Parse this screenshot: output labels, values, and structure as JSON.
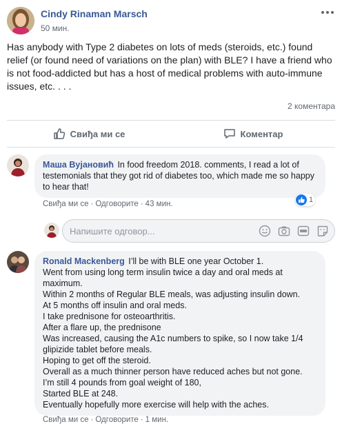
{
  "post": {
    "author": "Cindy Rinaman Marsch",
    "time": "50 мин.",
    "text": "Has anybody with Type 2 diabetes on lots of meds (steroids, etc.) found relief (or found need of variations on the plan) with BLE? I have a friend who is not food-addicted but has a host of medical problems with auto-immune issues, etc. . . .",
    "comment_count": "2 коментара"
  },
  "actions": {
    "like": "Свиђа ми се",
    "comment": "Коментар"
  },
  "comments": [
    {
      "author": "Маша Вујановић",
      "text": "In food freedom 2018. comments, I read a lot of testemonials that they got rid of diabetes too, which made me so happy to hear that!",
      "like": "Свиђа ми се",
      "reply": "Одговорите",
      "time": "43 мин.",
      "reactions": "1"
    },
    {
      "author": "Ronald Mackenberg",
      "first_line": "I’ll be with BLE one year October 1.",
      "lines": [
        "Went from using long term insulin twice a day and oral meds at maximum.",
        "Within 2 months of Regular BLE meals, was adjusting insulin down.",
        "At 5 months off insulin and oral meds.",
        "I take prednisone for osteoarthritis.",
        "After a flare up, the prednisone",
        "Was increased, causing the A1c numbers to spike, so I now take 1/4 glipizide tablet before meals.",
        "Hoping to get off the steroid.",
        "Overall as a much thinner person have reduced aches but not gone.",
        "I’m still 4 pounds from goal weight of 180,",
        "Started BLE at 248.",
        "Eventually hopefully more exercise will help with the aches."
      ],
      "like": "Свиђа ми се",
      "reply": "Одговорите",
      "time": "1 мин."
    }
  ],
  "reply_box": {
    "placeholder": "Напишите одговор..."
  },
  "colors": {
    "link_blue": "#385898",
    "like_blue": "#1877f2",
    "bubble_gray": "#f2f3f5",
    "meta_gray": "#606770"
  },
  "icons": [
    "more-icon",
    "like-icon",
    "comment-icon",
    "emoji-icon",
    "camera-icon",
    "gif-icon",
    "sticker-icon"
  ]
}
